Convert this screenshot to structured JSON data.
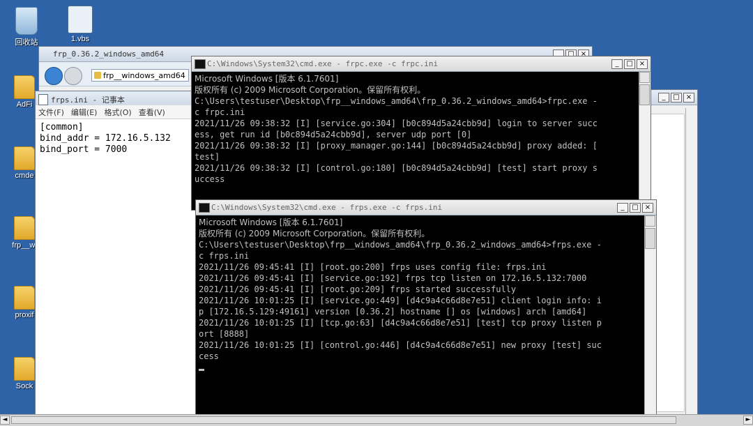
{
  "desktop": {
    "icons": [
      {
        "label": "回收站",
        "name": "recycle-bin-icon"
      },
      {
        "label": "1.vbs",
        "name": "script-icon"
      },
      {
        "label": "AdFi",
        "name": "folder-icon"
      },
      {
        "label": "cmde",
        "name": "folder-icon"
      },
      {
        "label": "frp__wi",
        "name": "folder-icon"
      },
      {
        "label": "proxif",
        "name": "folder-icon"
      },
      {
        "label": "Sock",
        "name": "folder-icon"
      }
    ]
  },
  "windows": {
    "explorer": {
      "title": "frp_0.36.2_windows_amd64",
      "path": "frp__windows_amd64"
    },
    "notepad": {
      "title": "frps.ini - 记事本",
      "menu": [
        "文件(F)",
        "编辑(E)",
        "格式(O)",
        "查看(V)"
      ],
      "lines": [
        "[common]",
        "bind_addr = 172.16.5.132",
        "bind_port = 7000"
      ]
    },
    "cmd_frpc": {
      "title": "C:\\Windows\\System32\\cmd.exe - frpc.exe  -c frpc.ini",
      "lines": [
        "Microsoft Windows [版本 6.1.7601]",
        "版权所有 (c) 2009 Microsoft Corporation。保留所有权利。",
        "",
        "C:\\Users\\testuser\\Desktop\\frp__windows_amd64\\frp_0.36.2_windows_amd64>frpc.exe -",
        "c frpc.ini",
        "2021/11/26 09:38:32 [I] [service.go:304] [b0c894d5a24cbb9d] login to server succ",
        "ess, get run id [b0c894d5a24cbb9d], server udp port [0]",
        "2021/11/26 09:38:32 [I] [proxy_manager.go:144] [b0c894d5a24cbb9d] proxy added: [",
        "test]",
        "2021/11/26 09:38:32 [I] [control.go:180] [b0c894d5a24cbb9d] [test] start proxy s",
        "uccess"
      ]
    },
    "cmd_frps": {
      "title": "C:\\Windows\\System32\\cmd.exe - frps.exe  -c frps.ini",
      "lines": [
        "Microsoft Windows [版本 6.1.7601]",
        "版权所有 (c) 2009 Microsoft Corporation。保留所有权利。",
        "",
        "C:\\Users\\testuser\\Desktop\\frp__windows_amd64\\frp_0.36.2_windows_amd64>frps.exe -",
        "c frps.ini",
        "2021/11/26 09:45:41 [I] [root.go:200] frps uses config file: frps.ini",
        "2021/11/26 09:45:41 [I] [service.go:192] frps tcp listen on 172.16.5.132:7000",
        "2021/11/26 09:45:41 [I] [root.go:209] frps started successfully",
        "2021/11/26 10:01:25 [I] [service.go:449] [d4c9a4c66d8e7e51] client login info: i",
        "p [172.16.5.129:49161] version [0.36.2] hostname [] os [windows] arch [amd64]",
        "2021/11/26 10:01:25 [I] [tcp.go:63] [d4c9a4c66d8e7e51] [test] tcp proxy listen p",
        "ort [8888]",
        "2021/11/26 10:01:25 [I] [control.go:446] [d4c9a4c66d8e7e51] new proxy [test] suc",
        "cess"
      ]
    }
  },
  "controls": {
    "min": "_",
    "max": "□",
    "close": "×",
    "up": "▲",
    "down": "▼",
    "left": "◄",
    "right": "►"
  }
}
